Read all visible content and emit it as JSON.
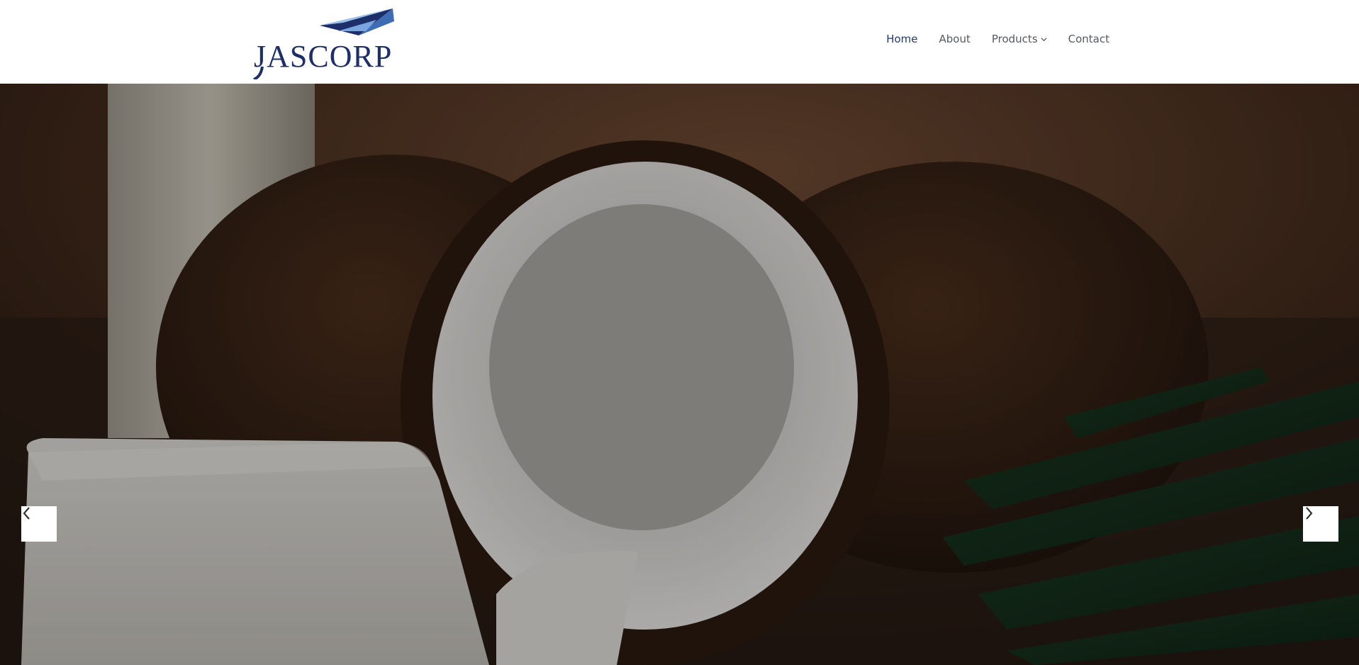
{
  "brand": {
    "logo_text": "JASCORP",
    "colors": {
      "primary": "#1d2f6b",
      "accent": "#6f9fd8"
    }
  },
  "nav": {
    "items": [
      {
        "label": "Home",
        "active": true
      },
      {
        "label": "About",
        "active": false
      },
      {
        "label": "Products",
        "active": false,
        "has_dropdown": true
      },
      {
        "label": "Contact",
        "active": false
      }
    ]
  },
  "hero": {
    "image_subject": "coconuts-and-soap",
    "prev_icon": "chevron-left-icon",
    "next_icon": "chevron-right-icon"
  }
}
